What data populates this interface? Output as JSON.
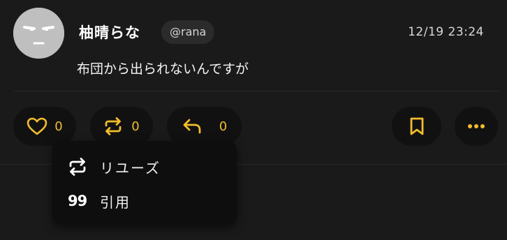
{
  "post": {
    "display_name": "柚晴らな",
    "handle": "@rana",
    "timestamp": "12/19 23:24",
    "text": "布団から出られないんですが",
    "avatar_icon": "expressionless-face-avatar"
  },
  "actions": {
    "like": {
      "icon": "heart-icon",
      "count": "0"
    },
    "repost": {
      "icon": "repost-icon",
      "count": "0"
    },
    "reply": {
      "icon": "reply-icon",
      "count": "0"
    },
    "bookmark": {
      "icon": "bookmark-icon"
    },
    "more": {
      "icon": "more-horizontal-icon"
    }
  },
  "repost_menu": {
    "items": [
      {
        "icon": "repost-icon",
        "label": "リユーズ"
      },
      {
        "icon_text": "99",
        "label": "引用"
      }
    ]
  },
  "colors": {
    "background": "#1b1a1b",
    "accent": "#f0bd2b",
    "button_bg": "#121112",
    "handle_pill": "#2c2b2c",
    "avatar": "#bfbfbf"
  }
}
